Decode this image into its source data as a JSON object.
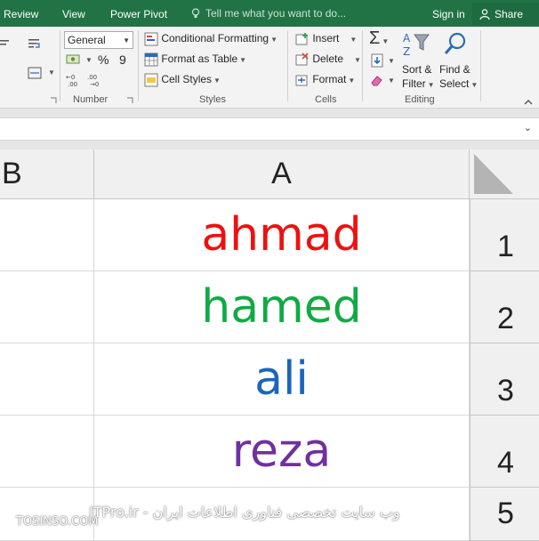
{
  "tabs": {
    "review": "Review",
    "view": "View",
    "power_pivot": "Power Pivot",
    "tell_me": "Tell me what you want to do...",
    "sign_in": "Sign in",
    "share": "Share"
  },
  "ribbon": {
    "number": {
      "format_value": "General",
      "percent_symbol": "%",
      "comma_symbol": "9",
      "group_label": "Number"
    },
    "styles": {
      "conditional_formatting": "Conditional Formatting",
      "format_as_table": "Format as Table",
      "cell_styles": "Cell Styles",
      "group_label": "Styles"
    },
    "cells": {
      "insert": "Insert",
      "delete": "Delete",
      "format": "Format",
      "group_label": "Cells"
    },
    "editing": {
      "sort_filter_1": "Sort &",
      "sort_filter_2": "Filter",
      "find_select_1": "Find &",
      "find_select_2": "Select",
      "group_label": "Editing"
    }
  },
  "grid": {
    "columns": [
      "B",
      "A"
    ],
    "rows": [
      {
        "number": "1",
        "value": "ahmad",
        "color": "#ee1111"
      },
      {
        "number": "2",
        "value": "hamed",
        "color": "#11aa44"
      },
      {
        "number": "3",
        "value": "ali",
        "color": "#1a66bb"
      },
      {
        "number": "4",
        "value": "reza",
        "color": "#7030a0"
      },
      {
        "number": "5",
        "value": "",
        "color": "#000000"
      }
    ]
  },
  "watermark": {
    "left": "TOSINSO.COM",
    "right": "ITPro.ir - وب سایت تخصصی فناوری اطلاعات ایران"
  },
  "colors": {
    "accent": "#217346"
  }
}
